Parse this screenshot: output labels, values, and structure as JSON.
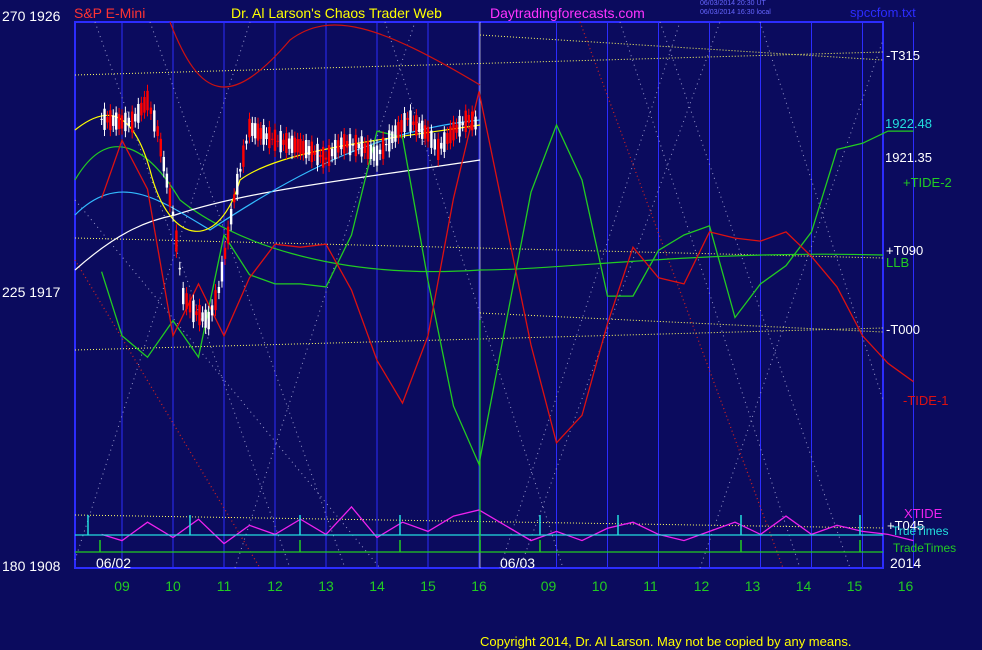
{
  "header": {
    "symbol_label": "S&P E-Mini",
    "title": "Dr. Al Larson's Chaos Trader Web",
    "website": "Daytradingforecasts.com",
    "timestamp_line1": "06/03/2014 20:30 UT",
    "timestamp_line2": "06/03/2014 16:30 local",
    "filename": "spccfom.txt"
  },
  "left_axis": {
    "top": "270  1926",
    "middle": "225  1917",
    "bottom": "180  1908"
  },
  "x_axis": {
    "day1_hours": [
      "09",
      "10",
      "11",
      "12",
      "13",
      "14",
      "15",
      "16"
    ],
    "day2_hours": [
      "09",
      "10",
      "11",
      "12",
      "13",
      "14",
      "15",
      "16"
    ],
    "day1_date": "06/02",
    "day2_date": "06/03",
    "year": "2014"
  },
  "right_labels": {
    "t315": "-T315",
    "price_last": "1922.48",
    "price_close": "1921.35",
    "tide2": "+TIDE-2",
    "t090": "+T090",
    "llb": "LLB",
    "t000": "-T000",
    "tide1": "-TIDE-1",
    "xtide": "XTIDE",
    "t045": "+T045",
    "truetimes": "TrueTimes",
    "tradetimes": "TradeTimes"
  },
  "footer": {
    "copyright": "Copyright 2014, Dr. Al Larson. May not be copied by any means."
  },
  "colors": {
    "background": "#0b0b5e",
    "grid": "#2c2cff",
    "price_up": "#ffffff",
    "price_down": "#ff0000",
    "tide2": "#22cc22",
    "tide1": "#dd1111",
    "xtide": "#ee22ee",
    "truetimes": "#22dddd",
    "tradetimes": "#22cc22",
    "magenta_text": "#ff33ff",
    "yellow_text": "#ffff00"
  },
  "chart_data": {
    "type": "line",
    "title": "S&P E-Mini",
    "ylim": [
      1908,
      1926
    ],
    "ticks_y": [
      1908,
      1917,
      1926
    ],
    "ticks_x": [
      "09",
      "10",
      "11",
      "12",
      "13",
      "14",
      "15",
      "16",
      "09",
      "10",
      "11",
      "12",
      "13",
      "14",
      "15",
      "16"
    ],
    "dates": [
      "06/02",
      "06/03"
    ],
    "price_levels": {
      "last": 1922.48,
      "close": 1921.35
    },
    "series": [
      {
        "name": "S&P E-Mini",
        "x": [
          8.6,
          9.0,
          9.2,
          9.5,
          9.7,
          10.0,
          10.2,
          10.4,
          10.7,
          10.9,
          11.2,
          11.5,
          12.0,
          12.5,
          13.0,
          13.3,
          13.7,
          14.0,
          14.3,
          14.6,
          15.0,
          15.2,
          15.5,
          15.8,
          16.0
        ],
        "values": [
          1922.6,
          1922.5,
          1922.5,
          1923.2,
          1922.2,
          1919.5,
          1916.8,
          1916.3,
          1916.0,
          1917.0,
          1920.0,
          1922.3,
          1921.9,
          1921.7,
          1921.3,
          1921.8,
          1921.7,
          1921.4,
          1922.0,
          1922.6,
          1922.1,
          1921.6,
          1922.2,
          1922.6,
          1922.4
        ]
      },
      {
        "name": "+TIDE-2",
        "x": [
          8.6,
          9,
          9.5,
          10,
          10.5,
          11,
          11.5,
          12,
          12.5,
          13,
          13.5,
          14,
          14.5,
          15,
          15.5,
          16,
          16.5,
          17,
          17.5,
          18,
          18.5,
          19,
          19.5,
          20,
          20.5,
          21,
          21.5,
          22,
          22.5,
          23,
          23.5,
          24
        ],
        "values": [
          1917.6,
          1915.5,
          1914.8,
          1916.0,
          1914.8,
          1918.8,
          1917.5,
          1917.2,
          1917.2,
          1917.1,
          1918.8,
          1922.2,
          1922.0,
          1917.3,
          1913.2,
          1911.3,
          1920.2,
          1922.4,
          1920.6,
          1916.8,
          1916.8,
          1918.3,
          1918.8,
          1919.1,
          1916.1,
          1917.2,
          1917.8,
          1918.9,
          1921.6,
          1921.8,
          1922.2,
          1922.2
        ]
      },
      {
        "name": "-TIDE-1",
        "x": [
          8.6,
          9,
          9.5,
          10,
          10.5,
          11,
          11.5,
          12,
          12.5,
          13,
          13.5,
          14,
          14.5,
          15,
          15.5,
          16,
          16.5,
          17,
          17.5,
          18,
          18.5,
          19,
          19.5,
          20,
          20.5,
          21,
          21.5,
          22,
          22.5,
          23,
          23.5,
          24
        ],
        "values": [
          1920.0,
          1921.9,
          1920.3,
          1915.5,
          1917.2,
          1915.5,
          1917.4,
          1918.5,
          1918.4,
          1918.5,
          1917.0,
          1914.7,
          1913.3,
          1915.5,
          1920.0,
          1923.5,
          1915.2,
          1912.0,
          1912.9,
          1915.9,
          1918.4,
          1917.4,
          1917.2,
          1918.9,
          1918.7,
          1918.6,
          1918.9,
          1918.1,
          1917.1,
          1915.5,
          1914.6,
          1914.0
        ]
      },
      {
        "name": "XTIDE",
        "x": [
          8.6,
          9,
          9.5,
          10,
          10.5,
          11,
          11.5,
          12,
          12.5,
          13,
          13.5,
          14,
          14.5,
          15,
          15.5,
          16,
          16.5,
          17,
          17.5,
          18,
          18.5,
          19,
          19.5,
          20,
          20.5,
          21,
          21.5,
          22,
          22.5,
          23,
          23.5,
          24
        ],
        "values": [
          1909.0,
          1908.8,
          1909.4,
          1908.9,
          1909.5,
          1908.7,
          1909.3,
          1909.0,
          1909.5,
          1909.0,
          1909.9,
          1908.9,
          1909.4,
          1909.1,
          1909.6,
          1909.8,
          1908.8,
          1909.1,
          1908.8,
          1909.2,
          1909.4,
          1909.0,
          1908.8,
          1909.1,
          1909.4,
          1909.0,
          1909.6,
          1909.0,
          1909.3,
          1909.1,
          1909.0,
          1908.8
        ]
      }
    ]
  }
}
